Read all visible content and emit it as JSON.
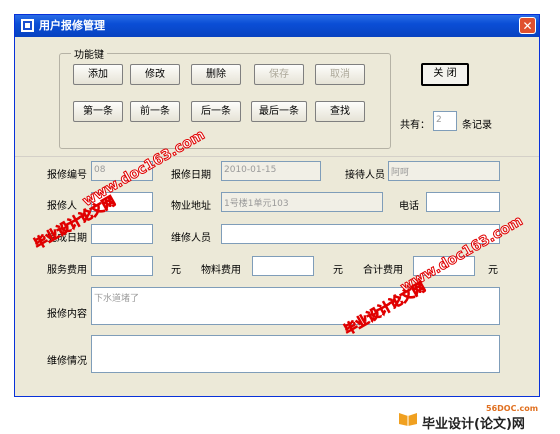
{
  "window": {
    "title": "用户报修管理",
    "close_glyph": "✕"
  },
  "toolbar": {
    "group_label": "功能键",
    "add": "添加",
    "edit": "修改",
    "delete": "删除",
    "save": "保存",
    "cancel": "取消",
    "first": "第一条",
    "prev": "前一条",
    "next": "后一条",
    "last": "最后一条",
    "find": "查找",
    "close": "关  闭"
  },
  "record_count": {
    "prefix": "共有：",
    "value": "2",
    "suffix": "条记录"
  },
  "form": {
    "repair_no_label": "报修编号",
    "repair_no_value": "08",
    "repair_date_label": "报修日期",
    "repair_date_value": "2010-01-15",
    "receiver_label": "接待人员",
    "receiver_value": "阿呵",
    "repairer_label": "报修人",
    "repairer_value": "",
    "address_label": "物业地址",
    "address_value": "1号楼1单元103",
    "phone_label": "电话",
    "phone_value": "",
    "finish_date_label": "完成日期",
    "finish_date_value": "",
    "maintainer_label": "维修人员",
    "maintainer_value": "",
    "service_fee_label": "服务费用",
    "service_fee_value": "",
    "unit_yuan": "元",
    "material_fee_label": "物料费用",
    "material_fee_value": "",
    "total_fee_label": "合计费用",
    "total_fee_value": "",
    "content_label": "报修内容",
    "content_value": "下水道堵了",
    "situation_label": "维修情况",
    "situation_value": ""
  },
  "watermarks": {
    "url": "www.doc163.com",
    "cn": "毕业设计论文网"
  },
  "footer": {
    "small": "56DOC.com",
    "text": "毕业设计(论文)网"
  },
  "colors": {
    "titlebar": "#0a4ed6",
    "window_bg": "#ece9d8",
    "watermark": "#e00000"
  }
}
